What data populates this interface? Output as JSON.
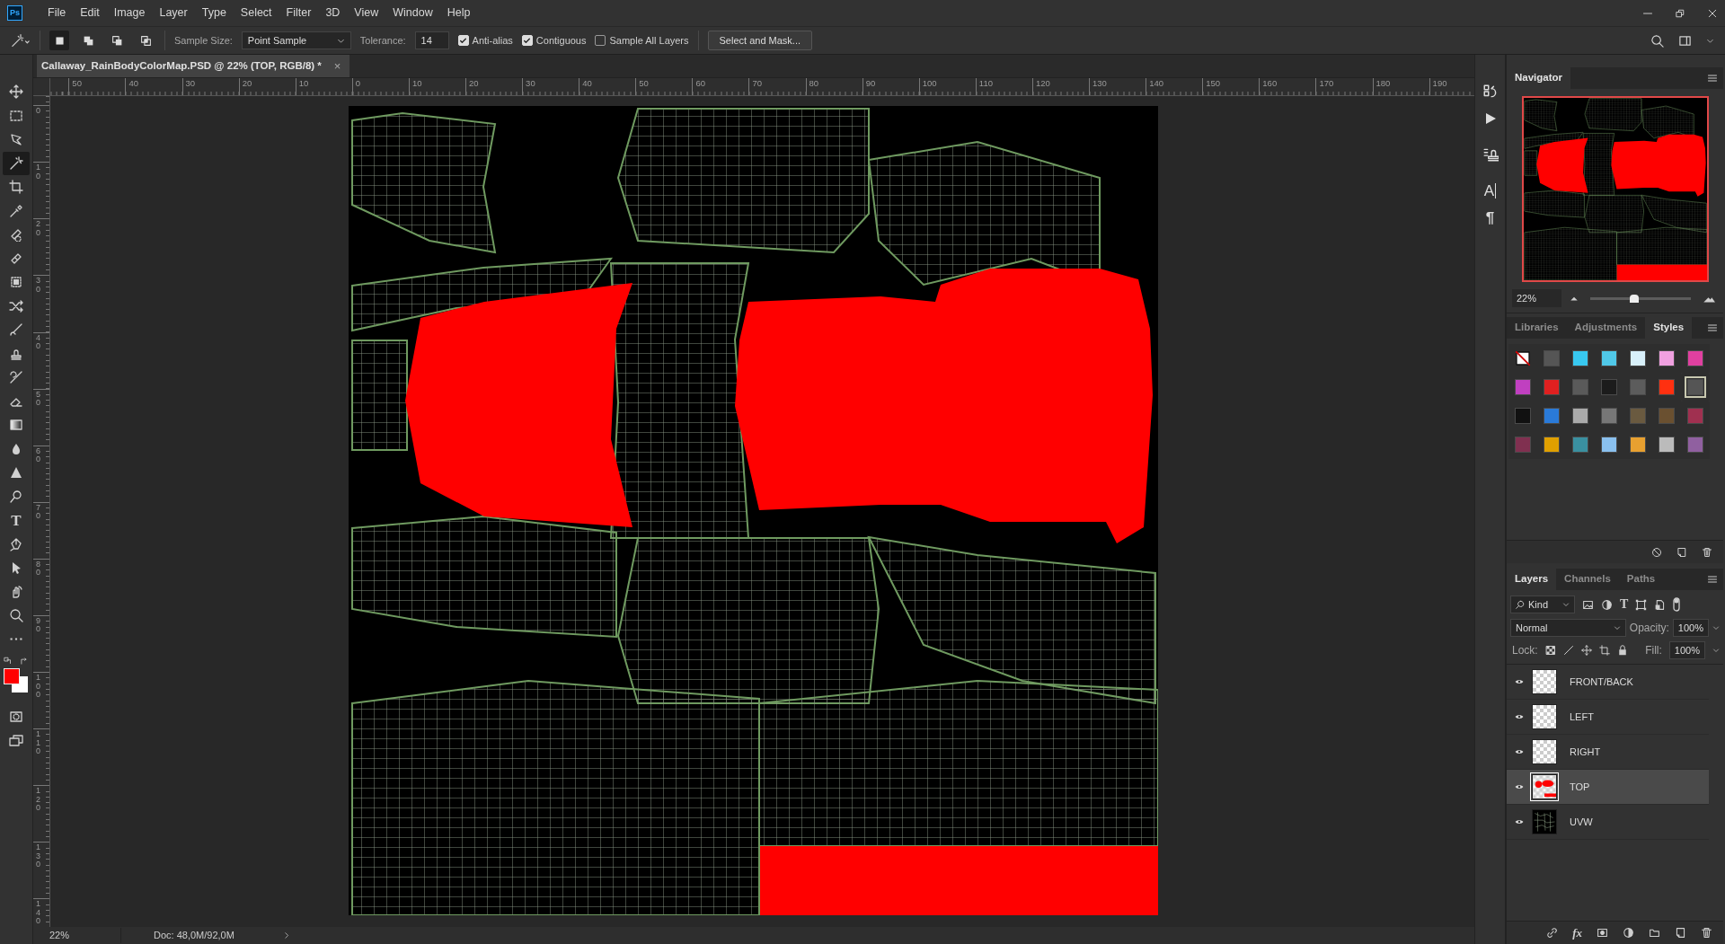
{
  "menu_bar": {
    "logo": "Ps",
    "items": [
      "File",
      "Edit",
      "Image",
      "Layer",
      "Type",
      "Select",
      "Filter",
      "3D",
      "View",
      "Window",
      "Help"
    ]
  },
  "options_bar": {
    "modes": [
      {
        "selected": true
      },
      {
        "selected": false
      },
      {
        "selected": false
      },
      {
        "selected": false
      }
    ],
    "sample_size_label": "Sample Size:",
    "sample_size": "Point Sample",
    "tolerance_label": "Tolerance:",
    "tolerance": "14",
    "checkboxes": [
      {
        "label": "Anti-alias",
        "checked": true
      },
      {
        "label": "Contiguous",
        "checked": true
      },
      {
        "label": "Sample All Layers",
        "checked": false
      }
    ],
    "select_and_mask": "Select and Mask..."
  },
  "document_tab": {
    "title": "Callaway_RainBodyColorMap.PSD @ 22% (TOP, RGB/8) *",
    "close": "×"
  },
  "rulers": {
    "horizontal": [
      "50",
      "40",
      "30",
      "20",
      "10",
      "0",
      "10",
      "20",
      "30",
      "40",
      "50",
      "60",
      "70",
      "80",
      "90",
      "100",
      "110",
      "120",
      "130",
      "140",
      "150",
      "160",
      "170",
      "180",
      "190"
    ],
    "vertical": [
      "0",
      "10",
      "20",
      "30",
      "40",
      "50",
      "60",
      "70",
      "80",
      "90",
      "100",
      "110",
      "120",
      "130",
      "140"
    ]
  },
  "tools": [
    {
      "kind": "move",
      "selected": false
    },
    {
      "kind": "marquee",
      "selected": false
    },
    {
      "kind": "lasso",
      "selected": false
    },
    {
      "kind": "wand",
      "selected": true
    },
    {
      "kind": "crop",
      "selected": false
    },
    {
      "kind": "eyedropper",
      "selected": false
    },
    {
      "kind": "spot",
      "selected": false
    },
    {
      "kind": "bandage",
      "selected": false
    },
    {
      "kind": "patch",
      "selected": false
    },
    {
      "kind": "aware",
      "selected": false
    },
    {
      "kind": "brush",
      "selected": false
    },
    {
      "kind": "stamp",
      "selected": false
    },
    {
      "kind": "history",
      "selected": false
    },
    {
      "kind": "eraser",
      "selected": false
    },
    {
      "kind": "gradient",
      "selected": false
    },
    {
      "kind": "blur",
      "selected": false
    },
    {
      "kind": "sharpen",
      "selected": false
    },
    {
      "kind": "dodge",
      "selected": false
    },
    {
      "kind": "type",
      "glyph": "T",
      "selected": false
    },
    {
      "kind": "pen",
      "selected": false
    },
    {
      "kind": "path",
      "selected": false
    },
    {
      "kind": "hand",
      "selected": false
    },
    {
      "kind": "zoom",
      "selected": false
    },
    {
      "kind": "more",
      "selected": false
    }
  ],
  "colors": {
    "foreground": {
      "color": "#ff0000"
    },
    "background": {
      "color": "#ffffff"
    }
  },
  "status_bar": {
    "zoom": "22%",
    "doc": "Doc: 48,0M/92,0M"
  },
  "side_icons": {
    "character": "A",
    "paragraph": "¶"
  },
  "navigator": {
    "title": "Navigator",
    "zoom": "22%",
    "level": 0.44
  },
  "style_tabs": [
    {
      "label": "Libraries",
      "selected": false
    },
    {
      "label": "Adjustments",
      "selected": false
    },
    {
      "label": "Styles",
      "selected": true
    }
  ],
  "styles": [
    {
      "kind": "none",
      "selected": false
    },
    {
      "kind": "plain",
      "color": "#555555",
      "selected": false
    },
    {
      "kind": "plain",
      "color": "#38c8f0",
      "selected": false
    },
    {
      "kind": "plain",
      "color": "#50c8e8",
      "selected": false
    },
    {
      "kind": "plain",
      "color": "#d8f0fa",
      "selected": false
    },
    {
      "kind": "plain",
      "color": "#f0a0e0",
      "selected": false
    },
    {
      "kind": "plain",
      "color": "#e040a0",
      "selected": false
    },
    {
      "kind": "plain",
      "color": "#c040c0",
      "selected": false
    },
    {
      "kind": "plain",
      "color": "#e02020",
      "selected": false
    },
    {
      "kind": "plain",
      "color": "#5a5a5a",
      "selected": false
    },
    {
      "kind": "plain",
      "color": "#1c1c1c",
      "selected": false
    },
    {
      "kind": "plain",
      "color": "#5c5c5c",
      "selected": false
    },
    {
      "kind": "plain",
      "color": "#ff3010",
      "selected": false
    },
    {
      "kind": "plain",
      "color": "#555555",
      "selected": true
    },
    {
      "kind": "plain",
      "color": "#111111",
      "selected": false
    },
    {
      "kind": "plain",
      "color": "#2a7ad8",
      "selected": false
    },
    {
      "kind": "plain",
      "color": "#aaaaaa",
      "selected": false
    },
    {
      "kind": "plain",
      "color": "#777777",
      "selected": false
    },
    {
      "kind": "plain",
      "color": "#6a5a40",
      "selected": false
    },
    {
      "kind": "plain",
      "color": "#6a5030",
      "selected": false
    },
    {
      "kind": "plain",
      "color": "#a03050",
      "selected": false
    },
    {
      "kind": "plain",
      "color": "#803050",
      "selected": false
    },
    {
      "kind": "plain",
      "color": "#e0a000",
      "selected": false
    },
    {
      "kind": "plain",
      "color": "#3a90a0",
      "selected": false
    },
    {
      "kind": "plain",
      "color": "#8ac0ee",
      "selected": false
    },
    {
      "kind": "plain",
      "color": "#e8a030",
      "selected": false
    },
    {
      "kind": "plain",
      "color": "#bbbbbb",
      "selected": false
    },
    {
      "kind": "plain",
      "color": "#9060a0",
      "selected": false
    }
  ],
  "layer_tabs": [
    {
      "label": "Layers",
      "selected": true
    },
    {
      "label": "Channels",
      "selected": false
    },
    {
      "label": "Paths",
      "selected": false
    }
  ],
  "layer_controls": {
    "filter": "Kind",
    "type_filter": "T",
    "blend_mode": "Normal",
    "opacity_label": "Opacity:",
    "opacity": "100%",
    "lock_label": "Lock:",
    "fill_label": "Fill:",
    "fill": "100%",
    "fx": "fx"
  },
  "layers": [
    {
      "name": "FRONT/BACK",
      "kind": "empty",
      "visible": true,
      "selected": false
    },
    {
      "name": "LEFT",
      "kind": "empty",
      "visible": true,
      "selected": false
    },
    {
      "name": "RIGHT",
      "kind": "empty",
      "visible": true,
      "selected": false
    },
    {
      "name": "TOP",
      "kind": "red",
      "visible": true,
      "selected": true
    },
    {
      "name": "UVW",
      "kind": "wire",
      "visible": true,
      "selected": false
    }
  ]
}
